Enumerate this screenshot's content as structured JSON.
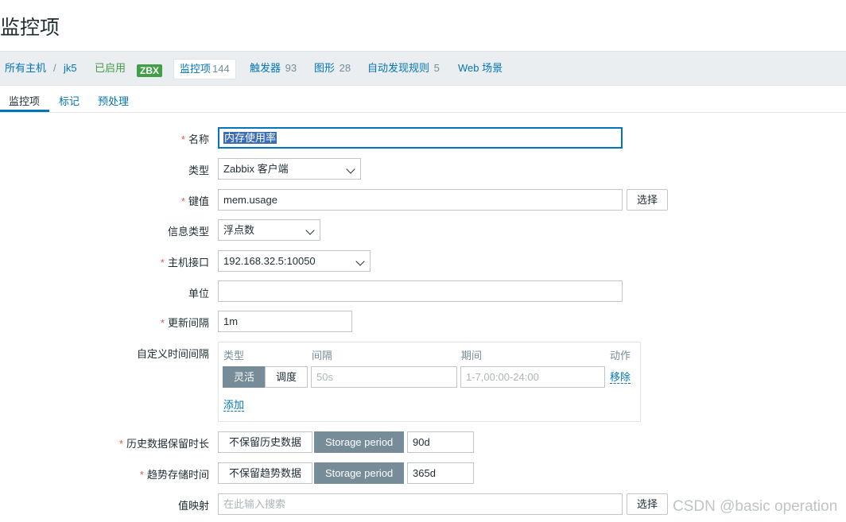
{
  "page": {
    "title": "监控项"
  },
  "breadcrumb": {
    "all_hosts": "所有主机",
    "separator": "/",
    "host": "jk5",
    "status": "已启用",
    "zbx_badge": "ZBX",
    "items": {
      "label": "监控项",
      "count": "144"
    },
    "triggers": {
      "label": "触发器",
      "count": "93"
    },
    "graphs": {
      "label": "图形",
      "count": "28"
    },
    "discovery": {
      "label": "自动发现规则",
      "count": "5"
    },
    "web": "Web 场景"
  },
  "subtabs": [
    "监控项",
    "标记",
    "预处理"
  ],
  "form": {
    "name": {
      "label": "名称",
      "value": "内存使用率"
    },
    "type": {
      "label": "类型",
      "value": "Zabbix 客户端"
    },
    "key": {
      "label": "键值",
      "value": "mem.usage",
      "button": "选择"
    },
    "info_type": {
      "label": "信息类型",
      "value": "浮点数"
    },
    "interface": {
      "label": "主机接口",
      "value": "192.168.32.5:10050"
    },
    "units": {
      "label": "单位",
      "value": ""
    },
    "update_interval": {
      "label": "更新间隔",
      "value": "1m"
    },
    "custom_intervals": {
      "label": "自定义时间间隔",
      "headers": {
        "type": "类型",
        "interval": "间隔",
        "period": "期间",
        "action": "动作"
      },
      "row": {
        "flexible": "灵活",
        "scheduling": "调度",
        "interval_placeholder": "50s",
        "period_placeholder": "1-7,00:00-24:00",
        "remove": "移除"
      },
      "add": "添加"
    },
    "history": {
      "label": "历史数据保留时长",
      "no_keep": "不保留历史数据",
      "storage": "Storage period",
      "value": "90d"
    },
    "trends": {
      "label": "趋势存储时间",
      "no_keep": "不保留趋势数据",
      "storage": "Storage period",
      "value": "365d"
    },
    "value_map": {
      "label": "值映射",
      "placeholder": "在此输入搜索",
      "button": "选择"
    }
  },
  "watermark": "CSDN @basic operation"
}
